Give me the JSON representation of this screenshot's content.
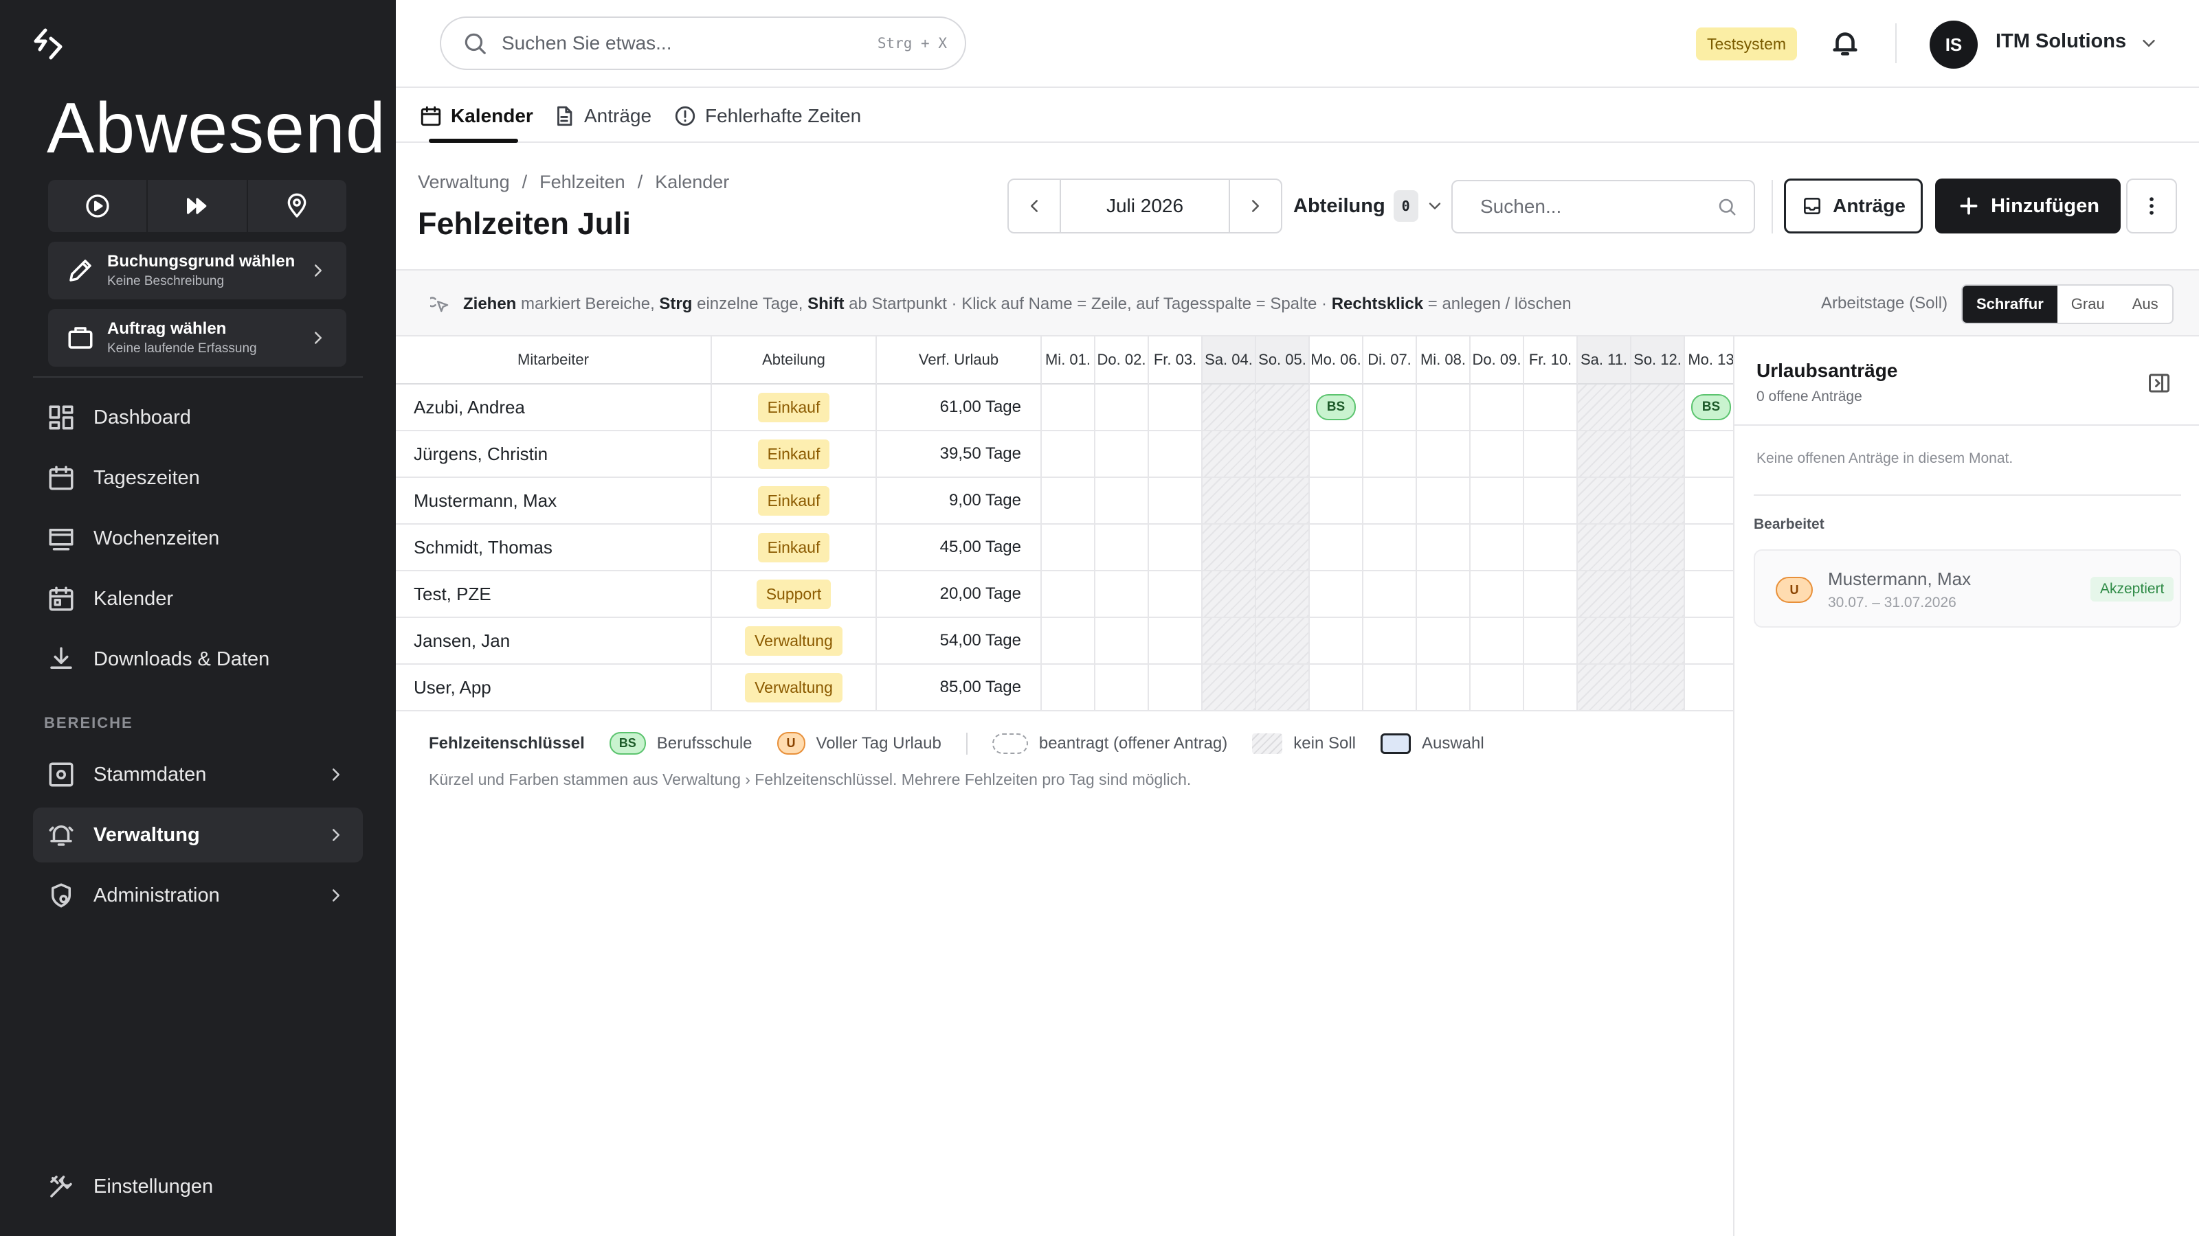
{
  "sidebar": {
    "app_title": "Abwesend",
    "controls": [
      "play-icon",
      "fast-forward-icon",
      "location-pin-icon"
    ],
    "booking_reason": {
      "title": "Buchungsgrund wählen",
      "subtitle": "Keine Beschreibung"
    },
    "order": {
      "title": "Auftrag wählen",
      "subtitle": "Keine laufende Erfassung"
    },
    "nav": [
      {
        "label": "Dashboard",
        "icon": "dashboard-icon"
      },
      {
        "label": "Tageszeiten",
        "icon": "calendar-icon"
      },
      {
        "label": "Wochenzeiten",
        "icon": "monitor-icon"
      },
      {
        "label": "Kalender",
        "icon": "calendar-icon"
      },
      {
        "label": "Downloads & Daten",
        "icon": "download-icon"
      }
    ],
    "section_label": "BEREICHE",
    "areas": [
      {
        "label": "Stammdaten",
        "icon": "settings-box-icon"
      },
      {
        "label": "Verwaltung",
        "icon": "bell-alert-icon",
        "active": true
      },
      {
        "label": "Administration",
        "icon": "shield-gear-icon"
      }
    ],
    "settings": "Einstellungen"
  },
  "topbar": {
    "search_placeholder": "Suchen Sie etwas...",
    "search_shortcut": "Strg + X",
    "env_badge": "Testsystem",
    "avatar_initials": "IS",
    "org_name": "ITM Solutions"
  },
  "tabs": [
    {
      "label": "Kalender",
      "active": true
    },
    {
      "label": "Anträge"
    },
    {
      "label": "Fehlerhafte Zeiten"
    }
  ],
  "header": {
    "breadcrumb": [
      "Verwaltung",
      "/",
      "Fehlzeiten",
      "/",
      "Kalender"
    ],
    "title": "Fehlzeiten Juli",
    "month": "Juli 2026",
    "department_label": "Abteilung",
    "department_count": "0",
    "search_placeholder": "Suchen...",
    "requests_button": "Anträge",
    "add_button": "Hinzufügen"
  },
  "hint": {
    "parts": [
      {
        "b": "Ziehen"
      },
      {
        "t": " markiert Bereiche, "
      },
      {
        "b": "Strg"
      },
      {
        "t": " einzelne Tage, "
      },
      {
        "b": "Shift"
      },
      {
        "t": " ab Startpunkt · Klick auf Name = Zeile, auf Tagesspalte = Spalte · "
      },
      {
        "b": "Rechtsklick"
      },
      {
        "t": " = anlegen / löschen"
      }
    ],
    "workdays_label": "Arbeitstage (Soll)",
    "modes": [
      "Schraffur",
      "Grau",
      "Aus"
    ],
    "active_mode": "Schraffur"
  },
  "grid": {
    "headers": {
      "employee": "Mitarbeiter",
      "department": "Abteilung",
      "vacation": "Verf. Urlaub"
    },
    "days": [
      {
        "label": "Mi. 01.",
        "weekend": false
      },
      {
        "label": "Do. 02.",
        "weekend": false
      },
      {
        "label": "Fr. 03.",
        "weekend": false
      },
      {
        "label": "Sa. 04.",
        "weekend": true
      },
      {
        "label": "So. 05.",
        "weekend": true
      },
      {
        "label": "Mo. 06.",
        "weekend": false
      },
      {
        "label": "Di. 07.",
        "weekend": false
      },
      {
        "label": "Mi. 08.",
        "weekend": false
      },
      {
        "label": "Do. 09.",
        "weekend": false
      },
      {
        "label": "Fr. 10.",
        "weekend": false
      },
      {
        "label": "Sa. 11.",
        "weekend": true
      },
      {
        "label": "So. 12.",
        "weekend": true
      },
      {
        "label": "Mo. 13",
        "weekend": false
      }
    ],
    "rows": [
      {
        "name": "Azubi, Andrea",
        "department": "Einkauf",
        "vacation": "61,00 Tage",
        "codes": {
          "5": "BS",
          "12": "BS"
        }
      },
      {
        "name": "Jürgens, Christin",
        "department": "Einkauf",
        "vacation": "39,50 Tage",
        "codes": {}
      },
      {
        "name": "Mustermann, Max",
        "department": "Einkauf",
        "vacation": "9,00 Tage",
        "codes": {}
      },
      {
        "name": "Schmidt, Thomas",
        "department": "Einkauf",
        "vacation": "45,00 Tage",
        "codes": {}
      },
      {
        "name": "Test, PZE",
        "department": "Support",
        "vacation": "20,00 Tage",
        "codes": {}
      },
      {
        "name": "Jansen, Jan",
        "department": "Verwaltung",
        "vacation": "54,00 Tage",
        "codes": {}
      },
      {
        "name": "User, App",
        "department": "Verwaltung",
        "vacation": "85,00 Tage",
        "codes": {}
      }
    ]
  },
  "legend": {
    "title": "Fehlzeitenschlüssel",
    "bs_code": "BS",
    "bs_label": "Berufsschule",
    "u_code": "U",
    "u_label": "Voller Tag Urlaub",
    "pending_label": "beantragt (offener Antrag)",
    "no_target_label": "kein Soll",
    "selection_label": "Auswahl",
    "note": "Kürzel und Farben stammen aus Verwaltung › Fehlzeitenschlüssel. Mehrere Fehlzeiten pro Tag sind möglich."
  },
  "panel": {
    "title": "Urlaubsanträge",
    "subtitle": "0 offene Anträge",
    "empty": "Keine offenen Anträge in diesem Monat.",
    "section": "Bearbeitet",
    "card": {
      "code": "U",
      "name": "Mustermann, Max",
      "dates": "30.07. – 31.07.2026",
      "status": "Akzeptiert"
    }
  },
  "colors": {
    "sidebar_bg": "#1f2023",
    "accent_dark": "#1a1b1e",
    "badge_yellow": "#fdeeb0",
    "bs_green": "#c9f3cf",
    "u_orange": "#ffdcb0",
    "status_green": "#2d8a45"
  }
}
